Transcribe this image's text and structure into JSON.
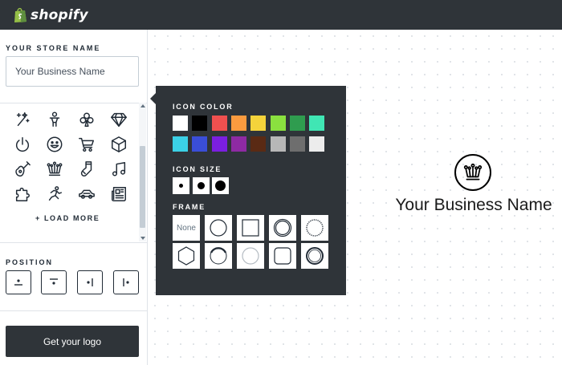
{
  "brand": {
    "name": "shopify",
    "color": "#95bf47"
  },
  "sidebar": {
    "store_name_label": "YOUR STORE NAME",
    "store_name_placeholder": "Your Business Name",
    "icons": [
      "magic-wand-icon",
      "person-icon",
      "club-icon",
      "diamond-icon",
      "power-icon",
      "smiley-icon",
      "shopping-cart-icon",
      "box-icon",
      "guitar-icon",
      "crown-icon",
      "sock-icon",
      "music-note-icon",
      "puzzle-icon",
      "runner-icon",
      "car-icon",
      "newspaper-icon"
    ],
    "load_more_label": "+ LOAD MORE",
    "position_label": "POSITION",
    "position_options": [
      "icon-above",
      "icon-top",
      "icon-right",
      "icon-left"
    ],
    "cta_label": "Get your logo"
  },
  "popover": {
    "icon_color_label": "ICON COLOR",
    "colors": [
      "#ffffff",
      "#000000",
      "#f0504f",
      "#fb9b3f",
      "#f5d33b",
      "#8ae03f",
      "#2f9c4f",
      "#40e6b4",
      "#3bd0e6",
      "#3a4ed8",
      "#7b1fe0",
      "#8e2aa3",
      "#5a2a14",
      "#b7b7b7",
      "#6e6e6e",
      "#ececec"
    ],
    "icon_size_label": "ICON SIZE",
    "sizes": [
      "small",
      "medium",
      "large"
    ],
    "frame_label": "FRAME",
    "frames": [
      "None",
      "circle",
      "square",
      "double-circle",
      "scalloped-circle",
      "hexagon",
      "bold-circle",
      "light-circle",
      "rounded-square",
      "thick-circle"
    ]
  },
  "preview": {
    "business_name": "Your Business Name"
  }
}
